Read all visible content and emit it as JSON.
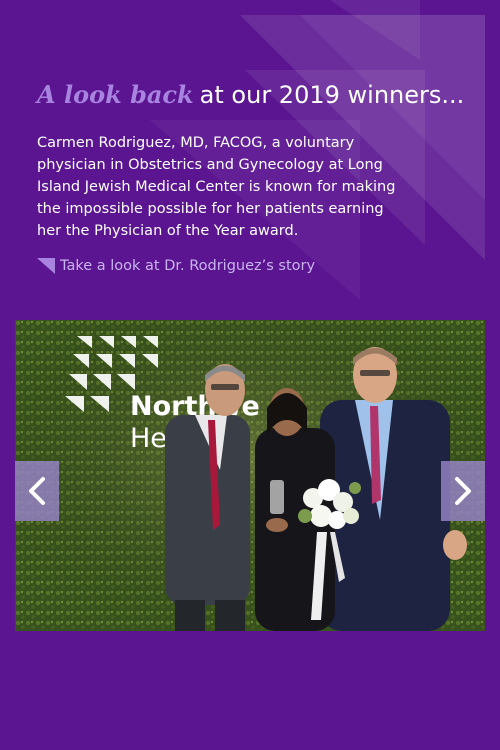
{
  "heading": {
    "accent": "A look back",
    "rest": "at our 2019 winners..."
  },
  "body_text": "Carmen Rodriguez, MD, FACOG, a voluntary physician in Obstetrics and Gynecology at Long Island Jewish Medical Center is known for making the impossible possible for her patients earning her the Physician of the Year award.",
  "story_link": {
    "label": "Take a look at Dr. Rodriguez’s story"
  },
  "carousel": {
    "photo_backdrop_text_1": "Northwe",
    "photo_backdrop_text_2": "He",
    "prev_icon": "chevron-left-icon",
    "next_icon": "chevron-right-icon"
  },
  "colors": {
    "background": "#5b1591",
    "accent": "#a883e0",
    "link": "#c9b3ef",
    "nav_button": "#9682c8"
  }
}
